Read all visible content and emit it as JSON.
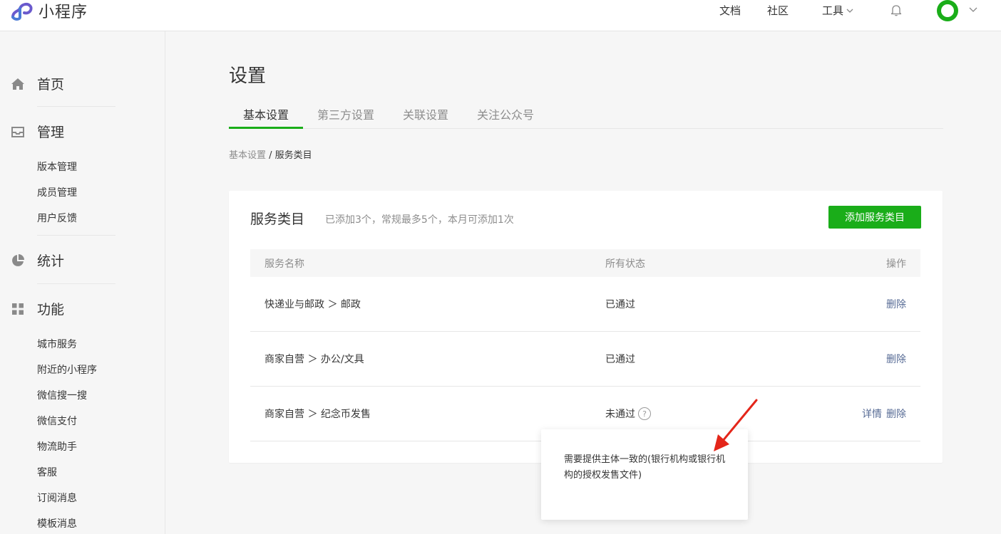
{
  "header": {
    "app_title": "小程序",
    "nav": {
      "docs": "文档",
      "community": "社区",
      "tools": "工具"
    }
  },
  "icons": {
    "logo": "mini-program-logo-icon",
    "bell": "bell-icon",
    "chevron": "chevron-down-icon",
    "home": "home-icon",
    "manage": "inbox-icon",
    "stats": "pie-chart-icon",
    "features": "grid-icon",
    "help": "question-mark-icon",
    "annotation": "red-arrow-icon"
  },
  "colors": {
    "accent": "#1aad19",
    "link": "#576b95",
    "annotation": "#e4261a"
  },
  "sidebar": {
    "home": "首页",
    "manage": {
      "label": "管理",
      "items": [
        "版本管理",
        "成员管理",
        "用户反馈"
      ]
    },
    "stats": "统计",
    "features": {
      "label": "功能",
      "items": [
        "城市服务",
        "附近的小程序",
        "微信搜一搜",
        "微信支付",
        "物流助手",
        "客服",
        "订阅消息",
        "模板消息"
      ]
    }
  },
  "main": {
    "title": "设置",
    "tabs": [
      "基本设置",
      "第三方设置",
      "关联设置",
      "关注公众号"
    ],
    "breadcrumb": {
      "parent": "基本设置",
      "sep": " / ",
      "current": "服务类目"
    },
    "card": {
      "title": "服务类目",
      "subtitle": "已添加3个，常规最多5个，本月可添加1次",
      "add_button": "添加服务类目",
      "columns": {
        "name": "服务名称",
        "status": "所有状态",
        "action": "操作"
      },
      "rows": [
        {
          "name": "快递业与邮政 ＞ 邮政",
          "status": "已通过",
          "detail": "",
          "delete": "删除"
        },
        {
          "name": "商家自营 ＞ 办公/文具",
          "status": "已通过",
          "detail": "",
          "delete": "删除"
        },
        {
          "name": "商家自营 ＞ 纪念币发售",
          "status": "未通过",
          "help": "?",
          "detail": "详情",
          "delete": "删除"
        }
      ]
    },
    "tooltip": "需要提供主体一致的(银行机构或银行机构的授权发售文件)"
  }
}
